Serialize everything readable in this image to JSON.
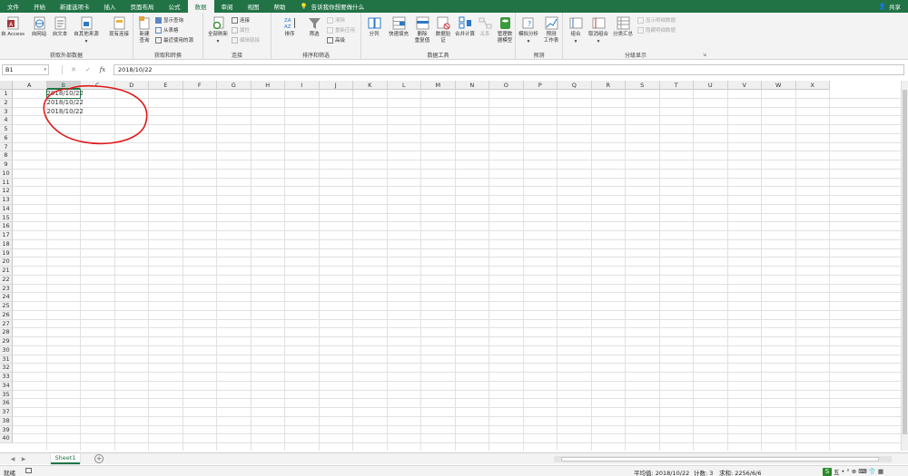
{
  "tabs": [
    "文件",
    "开始",
    "新建选项卡",
    "插入",
    "页面布局",
    "公式",
    "数据",
    "审阅",
    "视图",
    "帮助"
  ],
  "active_tab": "数据",
  "tell_me": "告诉我你想要做什么",
  "share": "共享",
  "ribbon": {
    "get_external": {
      "label": "获取外部数据",
      "access": "自 Access",
      "web": "自网站",
      "text": "自文本",
      "other": "自其他来源",
      "existing": "现有连接"
    },
    "get_transform": {
      "label": "获取和转换",
      "new_query": "新建\n查询",
      "show_queries": "显示查询",
      "from_table": "从表格",
      "recent_sources": "最近使用的源"
    },
    "connections": {
      "label": "连接",
      "refresh_all": "全部刷新",
      "connections": "连接",
      "properties": "属性",
      "edit_links": "编辑链接"
    },
    "sort_filter": {
      "label": "排序和筛选",
      "sort": "排序",
      "filter": "筛选",
      "clear": "清除",
      "reapply": "重新应用",
      "advanced": "高级"
    },
    "data_tools": {
      "label": "数据工具",
      "text_to_columns": "分列",
      "flash_fill": "快速填充",
      "remove_duplicates": "删除\n重复值",
      "validation": "数据验\n证",
      "consolidate": "合并计算",
      "relationships": "关系",
      "manage_model": "管理数\n据模型"
    },
    "forecast": {
      "label": "预测",
      "what_if": "模拟分析",
      "forecast_sheet": "预测\n工作表"
    },
    "outline": {
      "label": "分级显示",
      "group": "组合",
      "ungroup": "取消组合",
      "subtotal": "分类汇总",
      "show_detail": "显示明细数据",
      "hide_detail": "隐藏明细数据"
    }
  },
  "formula_bar": {
    "name_box": "B1",
    "cancel": "✕",
    "enter": "✓",
    "fx": "fx",
    "content": "2018/10/22"
  },
  "columns": [
    "A",
    "B",
    "C",
    "D",
    "E",
    "F",
    "G",
    "H",
    "I",
    "J",
    "K",
    "L",
    "M",
    "N",
    "O",
    "P",
    "Q",
    "R",
    "S",
    "T",
    "U",
    "V",
    "W",
    "X"
  ],
  "selected_column": "B",
  "rows": 40,
  "cells": [
    {
      "ref": "B1",
      "value": "2018/10/22"
    },
    {
      "ref": "B2",
      "value": "2018/10/22"
    },
    {
      "ref": "B3",
      "value": "2018/10/22"
    }
  ],
  "sheet": {
    "name": "Sheet1",
    "add": "+"
  },
  "status": {
    "ready": "就绪",
    "average": "平均值: 2018/10/22",
    "count": "计数: 3",
    "sum": "求和: 2256/6/6"
  },
  "ime": {
    "logo": "S",
    "mode": "五",
    "symbols": "• ° ⊕ ⌨ 👕 ▦"
  },
  "colors": {
    "excel_green": "#217346",
    "annotation_red": "#e01818"
  }
}
